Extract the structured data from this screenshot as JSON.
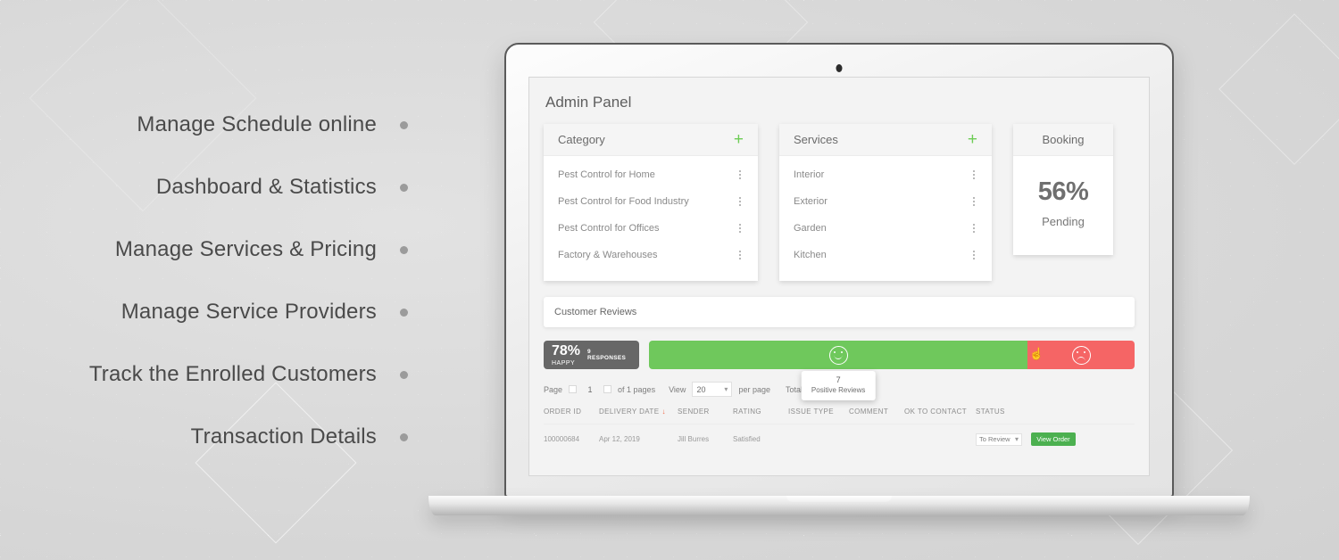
{
  "features": [
    {
      "label": "Manage Schedule online"
    },
    {
      "label": "Dashboard & Statistics"
    },
    {
      "label": "Manage Services & Pricing"
    },
    {
      "label": "Manage Service Providers"
    },
    {
      "label": "Track the Enrolled Customers"
    },
    {
      "label": "Transaction Details"
    }
  ],
  "screen": {
    "panel_title": "Admin Panel",
    "cards": {
      "category": {
        "title": "Category",
        "add_icon": "+",
        "items": [
          "Pest Control for Home",
          "Pest Control for Food Industry",
          "Pest Control for Offices",
          "Factory & Warehouses"
        ]
      },
      "services": {
        "title": "Services",
        "add_icon": "+",
        "items": [
          "Interior",
          "Exterior",
          "Garden",
          "Kitchen"
        ]
      },
      "booking": {
        "title": "Booking",
        "value": "56%",
        "label": "Pending"
      }
    },
    "reviews": {
      "title": "Customer Reviews",
      "happy_percent": "78%",
      "happy_word": "HAPPY",
      "responses": "9 RESPONSES",
      "positive_ratio": 78,
      "tooltip": {
        "count": "7",
        "label": "Positive Reviews"
      },
      "positive_color": "#6fc85c",
      "negative_color": "#f56565",
      "badge_color": "#676767"
    },
    "pagination": {
      "page_label": "Page",
      "page_value": "1",
      "of_pages": "of 1 pages",
      "view_label": "View",
      "per_page_value": "20",
      "per_page_label": "per page",
      "total_label": "Total 9 records found"
    },
    "table": {
      "headers": [
        "ORDER ID",
        "DELIVERY DATE",
        "SENDER",
        "RATING",
        "ISSUE TYPE",
        "COMMENT",
        "OK TO CONTACT",
        "STATUS"
      ],
      "sort_column": "DELIVERY DATE",
      "sort_arrow": "↓",
      "rows": [
        {
          "order_id": "100000684",
          "delivery_date": "Apr 12, 2019",
          "sender": "Jill Burres",
          "rating": "Satisfied",
          "issue_type": "",
          "comment": "",
          "ok_to_contact": "",
          "status": "To Review",
          "action": "View Order"
        }
      ]
    }
  }
}
